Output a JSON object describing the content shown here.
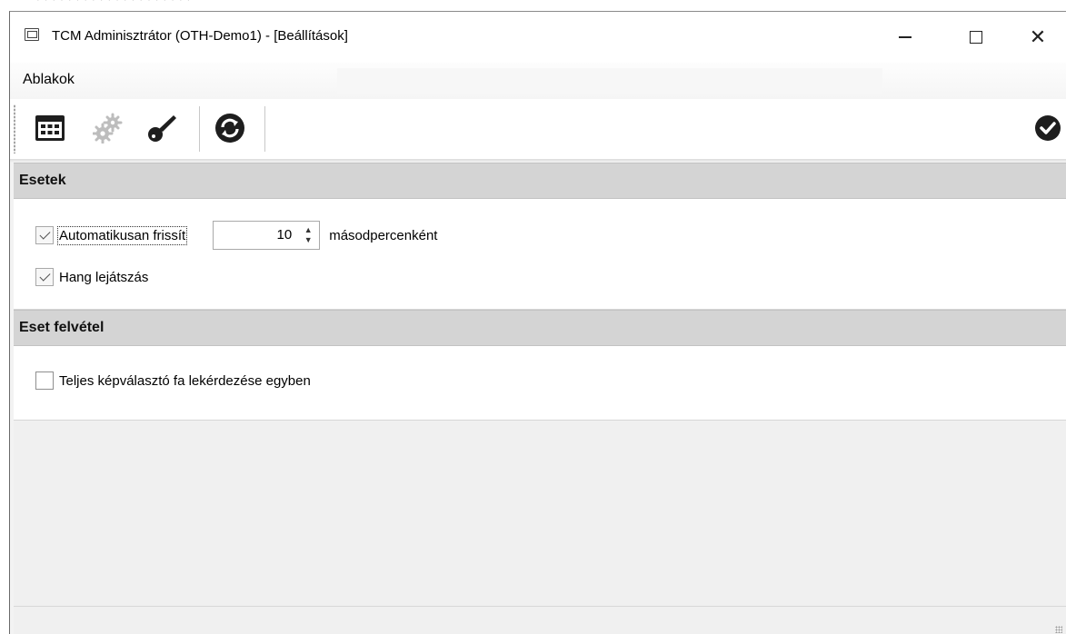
{
  "window": {
    "title": "TCM Adminisztrátor (OTH-Demo1) - [Beállítások]",
    "icon": "app-window-icon",
    "controls": {
      "minimize": "minimize-icon",
      "maximize": "maximize-icon",
      "close_glyph": "✕"
    }
  },
  "menu": {
    "items": [
      {
        "label": "Ablakok"
      }
    ]
  },
  "toolbar": {
    "buttons": [
      {
        "icon": "calendar-grid-icon"
      },
      {
        "icon": "gears-icon",
        "disabled": true
      },
      {
        "icon": "key-icon"
      },
      {
        "icon": "refresh-icon"
      }
    ],
    "confirm_icon": "checkmark-circle-icon"
  },
  "sections": [
    {
      "title": "Esetek",
      "auto_refresh": {
        "label": "Automatikusan frissít",
        "checked": true,
        "value": "10",
        "unit_label": "másodpercenként"
      },
      "sound": {
        "label": "Hang lejátszás",
        "checked": true
      }
    },
    {
      "title": "Eset felvétel",
      "full_tree": {
        "label": "Teljes képválasztó fa lekérdezése egyben",
        "checked": false
      }
    }
  ],
  "colors": {
    "section_header": "#d4d4d4",
    "content_bg": "#f0f0f0",
    "icon_dark": "#1e1e1e"
  }
}
